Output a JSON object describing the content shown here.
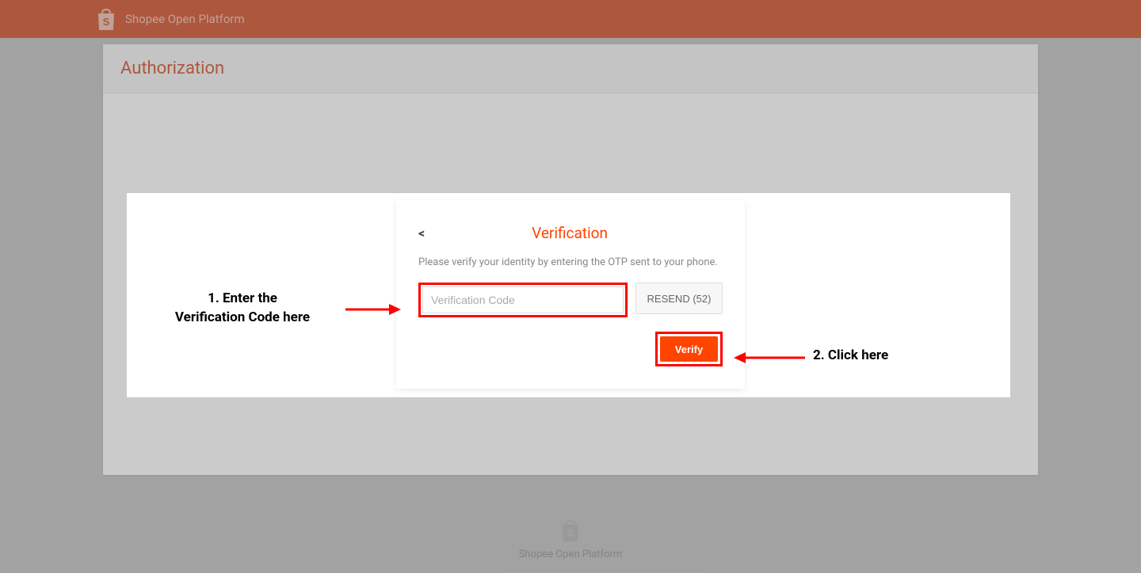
{
  "header": {
    "brand_title": "Shopee Open Platform"
  },
  "main": {
    "title": "Authorization"
  },
  "verification": {
    "back_symbol": "<",
    "title": "Verification",
    "instruction": "Please verify your identity by entering the OTP sent to your phone.",
    "input_placeholder": "Verification Code",
    "resend_label": "RESEND (52)",
    "verify_label": "Verify"
  },
  "annotations": {
    "step1_line1": "1. Enter the",
    "step1_line2": "Verification Code here",
    "step2": "2. Click here"
  },
  "footer": {
    "text": "Shopee Open Platform"
  },
  "colors": {
    "brand": "#c92c00",
    "accent": "#ff4400",
    "highlight": "#ff0000"
  }
}
